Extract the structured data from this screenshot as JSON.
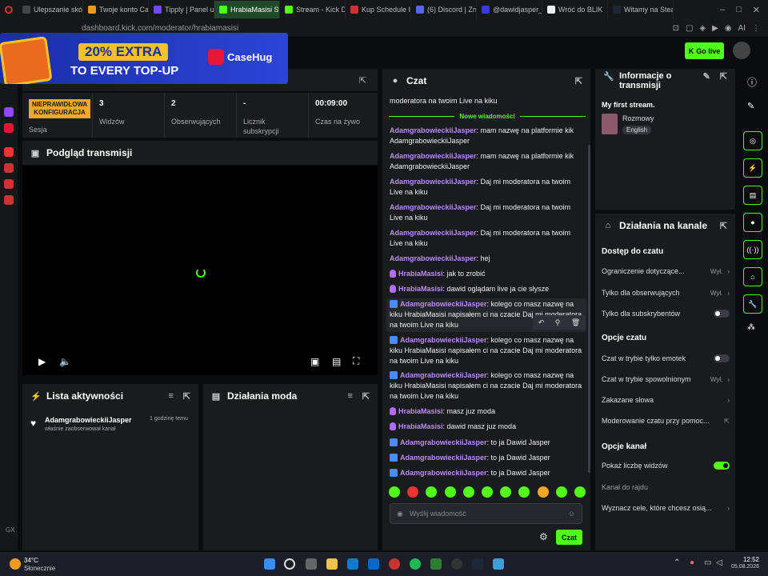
{
  "browser": {
    "tabs": [
      {
        "label": "Ulepszanie skó",
        "color": "#444",
        "active": false
      },
      {
        "label": "Twoje konto Ca",
        "color": "#e89a20",
        "active": false
      },
      {
        "label": "Tipply | Panel u",
        "color": "#6c4cf0",
        "active": false
      },
      {
        "label": "HrabiaMasisi Stream - Kick",
        "color": "#53fc18",
        "active": true
      },
      {
        "label": "Stream - Kick D",
        "color": "#53fc18",
        "active": false
      },
      {
        "label": "Kup Schedule I",
        "color": "#c33",
        "active": false
      },
      {
        "label": "(6) Discord | Zn",
        "color": "#5865f2",
        "active": false
      },
      {
        "label": "@dawidjasper_",
        "color": "#3b3bd6",
        "active": false
      },
      {
        "label": "Wróć do BLIK",
        "color": "#eee",
        "active": false
      },
      {
        "label": "Witamy na Stea",
        "color": "#1b2838",
        "active": false
      }
    ],
    "url": "dashboard.kick.com/moderator/hrabiamasisi"
  },
  "ad": {
    "extra": "20% EXTRA",
    "topup": "TO EVERY TOP-UP",
    "brand": "CaseHug"
  },
  "header": {
    "go_live": "Go live"
  },
  "stats": {
    "session_badge": "NIEPRAWIDŁOWA KONFIGURACJA",
    "session_label": "Sesja",
    "viewers_value": "3",
    "viewers_label": "Widzów",
    "followers_value": "2",
    "followers_label": "Obserwujących",
    "subs_value": "-",
    "subs_label": "Licznik subskrypcji",
    "live_value": "00:09:00",
    "live_label": "Czas na żywo"
  },
  "preview": {
    "title": "Podgląd transmisji"
  },
  "chat": {
    "title": "Czat",
    "top_text": "moderatora na twoim Live na kiku",
    "new_messages": "Nowe wiadomości",
    "messages": [
      {
        "user": "AdamgrabowieckiiJasper",
        "text": ": mam nazwę na platformie kik AdamgrabowieckiiJasper",
        "badge": ""
      },
      {
        "user": "AdamgrabowieckiiJasper",
        "text": ": mam nazwę na platformie kik AdamgrabowieckiiJasper",
        "badge": ""
      },
      {
        "user": "AdamgrabowieckiiJasper",
        "text": ": Daj mi moderatora na twoim Live na kiku",
        "badge": ""
      },
      {
        "user": "AdamgrabowieckiiJasper",
        "text": ": Daj mi moderatora na twoim Live na kiku",
        "badge": ""
      },
      {
        "user": "AdamgrabowieckiiJasper",
        "text": ": Daj mi moderatora na twoim Live na kiku",
        "badge": ""
      },
      {
        "user": "AdamgrabowieckiiJasper",
        "text": ": hej",
        "badge": ""
      },
      {
        "user": "HrabiaMasisi",
        "text": ": jak to zrobić",
        "badge": "mic"
      },
      {
        "user": "HrabiaMasisi",
        "text": ": dawid oglądam live ja cie słysze",
        "badge": "mic"
      },
      {
        "user": "AdamgrabowieckiiJasper",
        "text": ": kolego co masz nazwę na kiku HrabiaMasisi napisałem ci na czacie Daj mi moderatora na twoim Live na kiku",
        "badge": "pin"
      },
      {
        "user": "AdamgrabowieckiiJasper",
        "text": ": kolego co masz nazwę na kiku HrabiaMasisi napisałem ci na czacie Daj mi moderatora na twoim Live na kiku",
        "badge": "pin"
      },
      {
        "user": "AdamgrabowieckiiJasper",
        "text": ": kolego co masz nazwę na kiku HrabiaMasisi napisałem ci na czacie Daj mi moderatora na twoim Live na kiku",
        "badge": "pin"
      },
      {
        "user": "HrabiaMasisi",
        "text": ": masz juz moda",
        "badge": "mic"
      },
      {
        "user": "HrabiaMasisi",
        "text": ": dawid masz juz moda",
        "badge": "mic"
      },
      {
        "user": "AdamgrabowieckiiJasper",
        "text": ": to ja Dawid Jasper",
        "badge": "pin"
      },
      {
        "user": "AdamgrabowieckiiJasper",
        "text": ": to ja Dawid Jasper",
        "badge": "pin"
      },
      {
        "user": "AdamgrabowieckiiJasper",
        "text": ": to ja Dawid Jasper",
        "badge": "pin"
      }
    ],
    "input_placeholder": "Wyślij wiadomość",
    "send_label": "Czat"
  },
  "info": {
    "title": "Informacje o transmisji",
    "stream_title": "My first stream.",
    "category": "Rozmowy",
    "language": "English"
  },
  "actions": {
    "title": "Działania na kanale",
    "section1": "Dostęp do czatu",
    "restriction": "Ograniczenie dotyczące...",
    "restriction_val": "Wył.",
    "followers_only": "Tylko dla obserwujących",
    "followers_only_val": "Wył.",
    "subs_only": "Tylko dla subskrybentów",
    "section2": "Opcje czatu",
    "emote_only": "Czat w trybie tylko emotek",
    "slow_mode": "Czat w trybie spowolnionym",
    "slow_mode_val": "Wył.",
    "banned_words": "Zakazane słowa",
    "moderation": "Moderowanie czatu przy pomoc...",
    "section3": "Opcje kanał",
    "show_viewers": "Pokaż liczbę widzów",
    "raid_channel": "Kanał do rajdu",
    "goals": "Wyznacz cele, które chcesz osią..."
  },
  "activity": {
    "title": "Lista aktywności",
    "user": "AdamgrabowieckiiJasper",
    "event": "właśnie zaobserwował kanał",
    "time": "1 godzinę temu"
  },
  "modact": {
    "title": "Działania moda"
  },
  "taskbar": {
    "temp": "34°C",
    "weather": "Słonecznie",
    "time": "12:52",
    "date": "05.08.2026"
  }
}
